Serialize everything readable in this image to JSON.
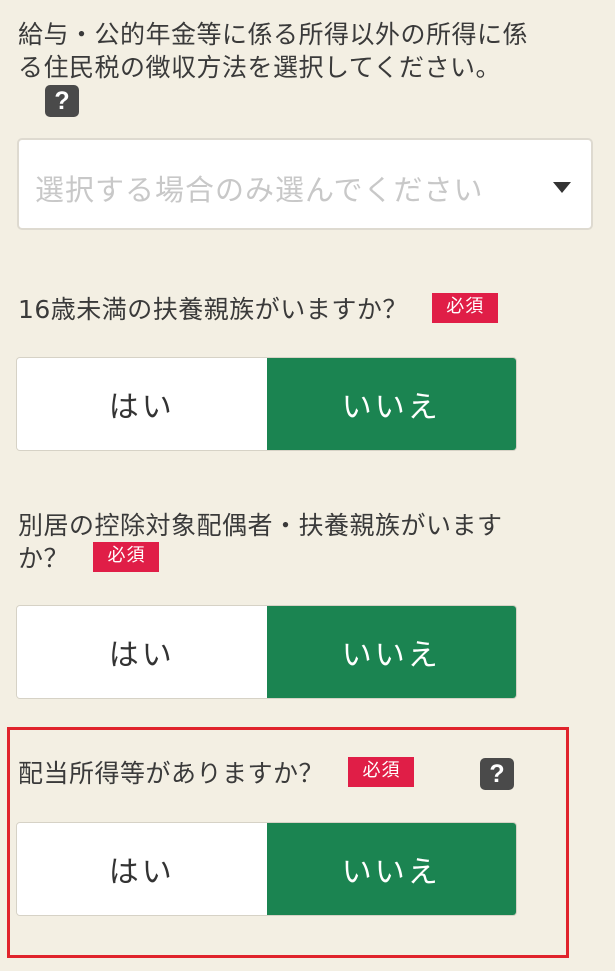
{
  "q1": {
    "title_line1": "給与・公的年金等に係る所得以外の所得に係",
    "title_line2": "る住民税の徴収方法を選択してください。",
    "help": "?",
    "placeholder": "選択する場合のみ選んでください"
  },
  "q2": {
    "title": "16歳未満の扶養親族がいますか？",
    "required": "必須",
    "yes": "はい",
    "no": "いいえ"
  },
  "q3": {
    "title_line1": "別居の控除対象配偶者・扶養親族がいます",
    "title_line2": "か？",
    "required": "必須",
    "yes": "はい",
    "no": "いいえ"
  },
  "q4": {
    "title": "配当所得等がありますか？",
    "required": "必須",
    "help": "?",
    "yes": "はい",
    "no": "いいえ"
  },
  "colors": {
    "selected_green": "#1b8451",
    "required_red": "#e01e47",
    "highlight_red": "#e0242c",
    "background": "#f3efe3"
  }
}
